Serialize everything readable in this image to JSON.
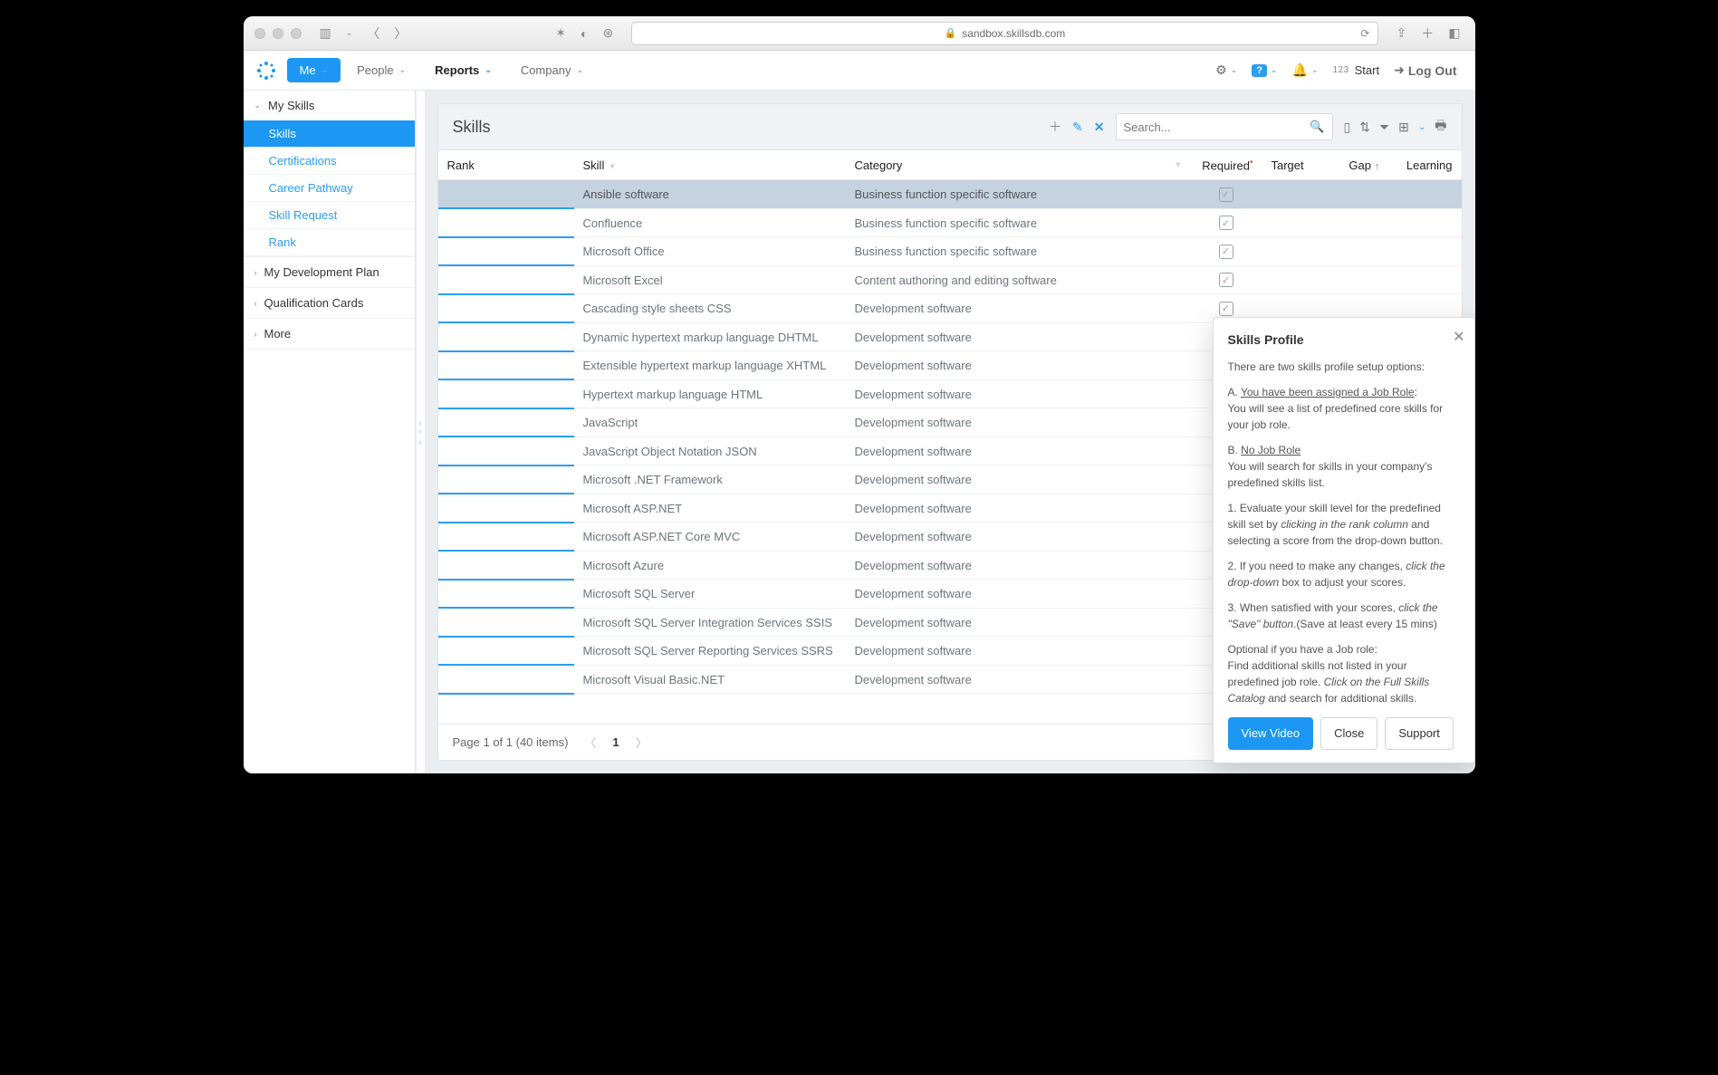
{
  "browser": {
    "url": "sandbox.skillsdb.com"
  },
  "header": {
    "nav": [
      {
        "label": "Me",
        "type": "primary"
      },
      {
        "label": "People",
        "type": "plain"
      },
      {
        "label": "Reports",
        "type": "active"
      },
      {
        "label": "Company",
        "type": "plain"
      }
    ],
    "help_badge": "?",
    "start": "Start",
    "start_prefix": "123",
    "logout": "Log Out"
  },
  "sidebar": {
    "my_skills": "My Skills",
    "items": [
      "Skills",
      "Certifications",
      "Career Pathway",
      "Skill Request",
      "Rank"
    ],
    "dev_plan": "My Development Plan",
    "qual": "Qualification Cards",
    "more": "More"
  },
  "panel": {
    "title": "Skills",
    "search_placeholder": "Search..."
  },
  "columns": {
    "rank": "Rank",
    "skill": "Skill",
    "category": "Category",
    "required": "Required",
    "target": "Target",
    "gap": "Gap",
    "learning": "Learning"
  },
  "rows": [
    {
      "skill": "Ansible software",
      "category": "Business function specific software",
      "sel": true
    },
    {
      "skill": "Confluence",
      "category": "Business function specific software"
    },
    {
      "skill": "Microsoft Office",
      "category": "Business function specific software"
    },
    {
      "skill": "Microsoft Excel",
      "category": "Content authoring and editing software"
    },
    {
      "skill": "Cascading style sheets CSS",
      "category": "Development software"
    },
    {
      "skill": "Dynamic hypertext markup language DHTML",
      "category": "Development software"
    },
    {
      "skill": "Extensible hypertext markup language XHTML",
      "category": "Development software"
    },
    {
      "skill": "Hypertext markup language HTML",
      "category": "Development software"
    },
    {
      "skill": "JavaScript",
      "category": "Development software"
    },
    {
      "skill": "JavaScript Object Notation JSON",
      "category": "Development software"
    },
    {
      "skill": "Microsoft .NET Framework",
      "category": "Development software"
    },
    {
      "skill": "Microsoft ASP.NET",
      "category": "Development software"
    },
    {
      "skill": "Microsoft ASP.NET Core MVC",
      "category": "Development software"
    },
    {
      "skill": "Microsoft Azure",
      "category": "Development software"
    },
    {
      "skill": "Microsoft SQL Server",
      "category": "Development software"
    },
    {
      "skill": "Microsoft SQL Server Integration Services SSIS",
      "category": "Development software"
    },
    {
      "skill": "Microsoft SQL Server Reporting Services SSRS",
      "category": "Development software"
    },
    {
      "skill": "Microsoft Visual Basic.NET",
      "category": "Development software"
    }
  ],
  "pager": {
    "text": "Page 1 of 1 (40 items)",
    "page": "1"
  },
  "popup": {
    "title": "Skills Profile",
    "intro": "There are two skills profile setup options:",
    "aLabel": "A. ",
    "aUnder": "You have been assigned a Job Role",
    "aTail": ":",
    "aBody": "You will see a list of predefined core skills for your job role.",
    "bLabel": "B. ",
    "bUnder": "No Job Role",
    "bBody": "You will search for skills in your company's predefined skills list.",
    "s1a": "1. Evaluate your skill level for the predefined skill set by ",
    "s1i": "clicking in the rank column",
    "s1b": " and selecting a score from the drop-down button.",
    "s2a": "2. If you need to make any changes, ",
    "s2i": "click the drop-down",
    "s2b": " box to adjust your scores.",
    "s3a": "3. When satisfied with your scores, ",
    "s3i": "click the \"Save\" button",
    "s3b": ".(Save at least every 15 mins)",
    "opt1": "Optional if you have a Job role:",
    "opt2a": "Find additional skills not listed in your predefined job role.  ",
    "opt2i": "Click on the Full Skills Catalog",
    "opt2b": " and search for additional skills.",
    "view": "View Video",
    "close": "Close",
    "support": "Support"
  }
}
